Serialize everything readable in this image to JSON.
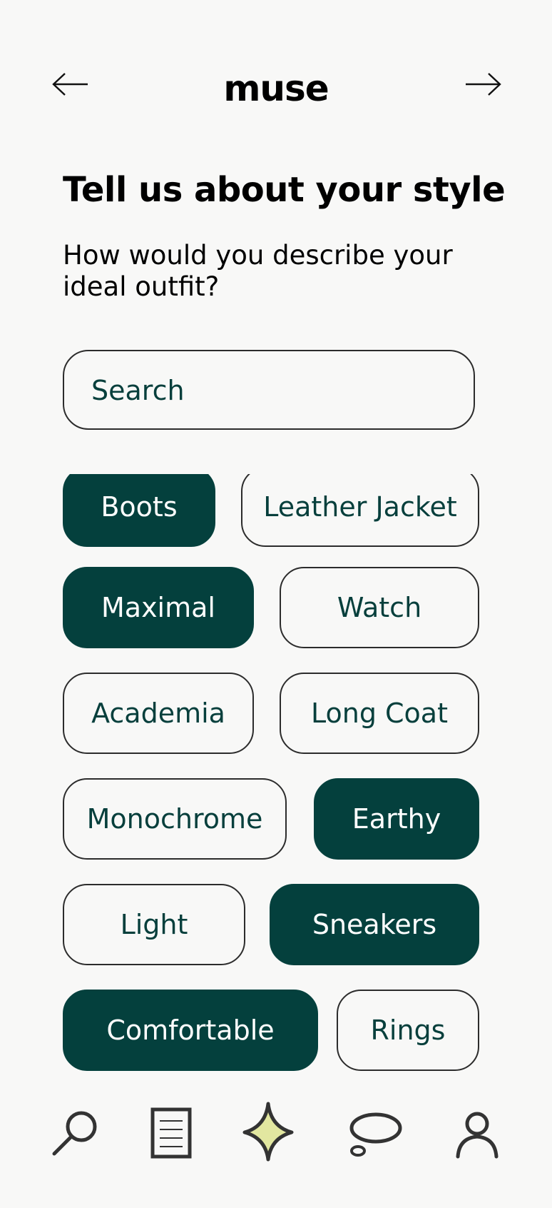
{
  "app": {
    "brand": "muse"
  },
  "header": {
    "back_icon": "arrow-left-icon",
    "forward_icon": "arrow-right-icon"
  },
  "main": {
    "title": "Tell us about your style",
    "subtitle": "How would you describe your ideal outfit?",
    "search": {
      "placeholder": "Search",
      "value": ""
    },
    "chips": [
      {
        "label": "Boots",
        "selected": true
      },
      {
        "label": "Leather Jacket",
        "selected": false
      },
      {
        "label": "Maximal",
        "selected": true
      },
      {
        "label": "Watch",
        "selected": false
      },
      {
        "label": "Academia",
        "selected": false
      },
      {
        "label": "Long Coat",
        "selected": false
      },
      {
        "label": "Monochrome",
        "selected": false
      },
      {
        "label": "Earthy",
        "selected": true
      },
      {
        "label": "Light",
        "selected": false
      },
      {
        "label": "Sneakers",
        "selected": true
      },
      {
        "label": "Comfortable",
        "selected": true
      },
      {
        "label": "Rings",
        "selected": false
      }
    ]
  },
  "tabbar": {
    "items": [
      {
        "icon": "search-icon",
        "active": false
      },
      {
        "icon": "document-icon",
        "active": false
      },
      {
        "icon": "sparkle-icon",
        "active": true
      },
      {
        "icon": "chat-bubble-icon",
        "active": false
      },
      {
        "icon": "profile-icon",
        "active": false
      }
    ]
  },
  "colors": {
    "background": "#f8f8f7",
    "accent": "#04403d",
    "accent_text": "#073f3c",
    "sparkle_fill": "#e2e7a0",
    "outline": "#2c2c2c"
  }
}
